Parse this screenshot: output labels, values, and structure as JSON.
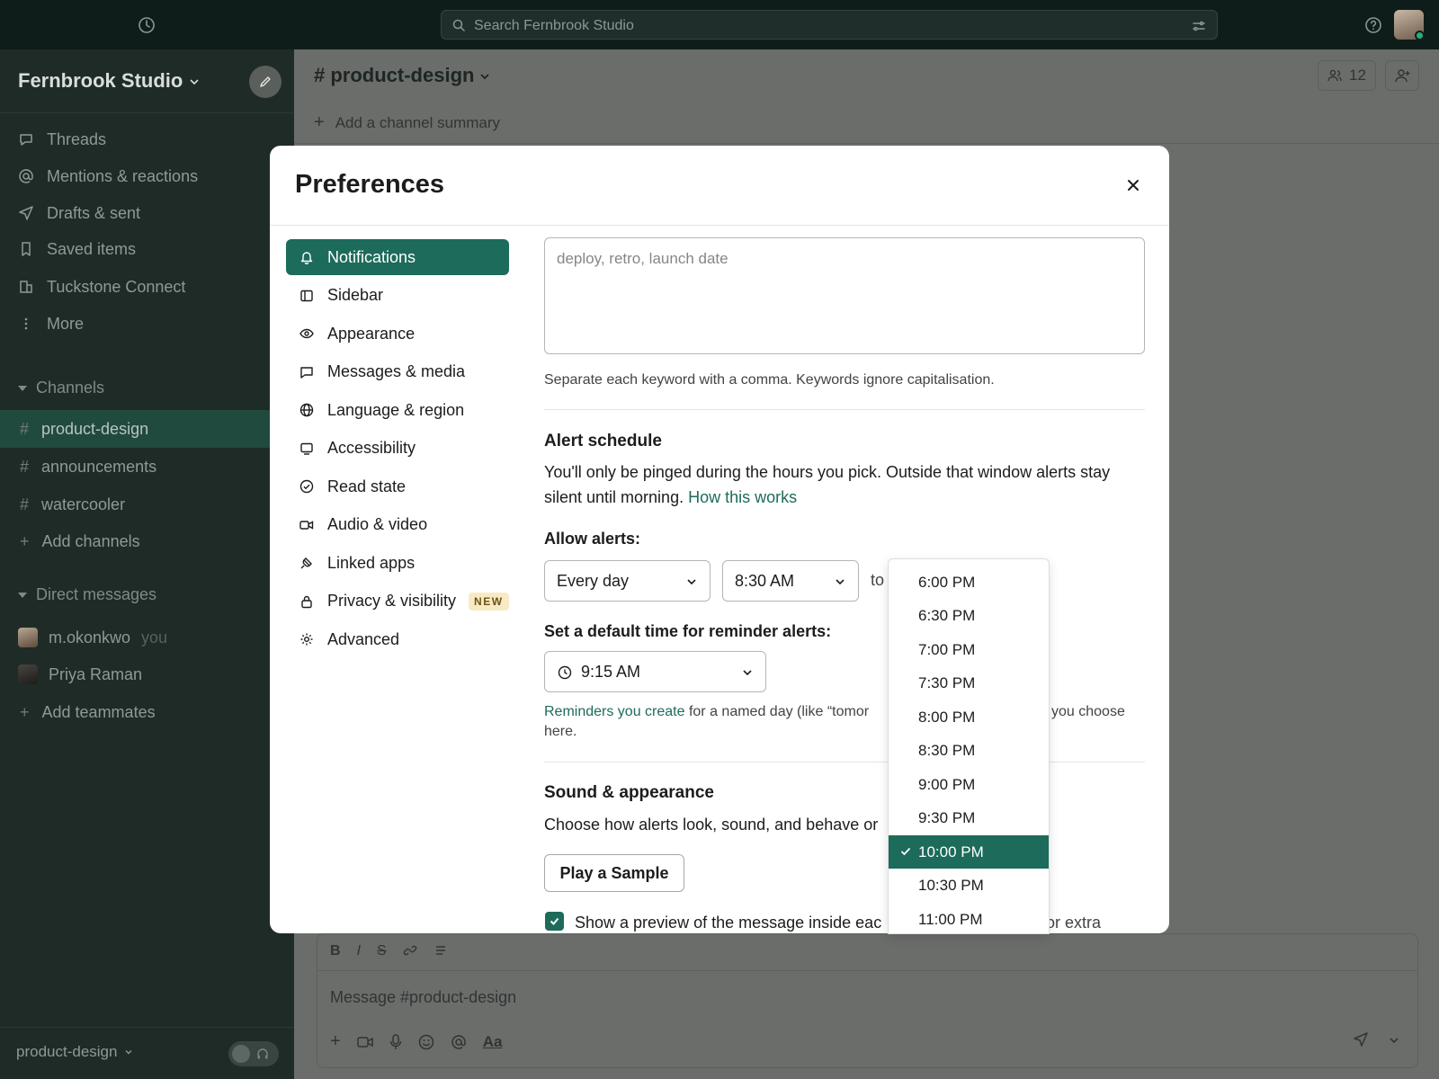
{
  "topbar": {
    "search_placeholder": "Search Fernbrook Studio"
  },
  "sidebar": {
    "workspace": "Fernbrook Studio",
    "nav": [
      {
        "label": "Threads",
        "icon": "threads-icon"
      },
      {
        "label": "Mentions & reactions",
        "icon": "at-icon"
      },
      {
        "label": "Drafts & sent",
        "icon": "send-icon"
      },
      {
        "label": "Saved items",
        "icon": "bookmark-icon"
      },
      {
        "label": "Tuckstone Connect",
        "icon": "connect-icon"
      },
      {
        "label": "More",
        "icon": "more-icon"
      }
    ],
    "channels_heading": "Channels",
    "channels": [
      "product-design",
      "announcements",
      "watercooler"
    ],
    "add_channels": "Add channels",
    "dm_heading": "Direct messages",
    "dms": [
      {
        "name": "m.okonkwo",
        "suffix": "you"
      },
      {
        "name": "Priya Raman",
        "suffix": ""
      }
    ],
    "add_teammates": "Add teammates",
    "footer_channel": "product-design"
  },
  "channel": {
    "title": "# product-design",
    "members_count": "12",
    "summary": "Add a channel summary",
    "composer_placeholder": "Message #product-design",
    "format_buttons": [
      "B",
      "I",
      "S"
    ],
    "aa_label": "Aa"
  },
  "modal": {
    "title": "Preferences",
    "menu": [
      {
        "label": "Notifications",
        "icon": "bell-icon",
        "active": true
      },
      {
        "label": "Sidebar",
        "icon": "sidebar-icon"
      },
      {
        "label": "Appearance",
        "icon": "eye-icon"
      },
      {
        "label": "Messages & media",
        "icon": "message-icon"
      },
      {
        "label": "Language & region",
        "icon": "globe-icon"
      },
      {
        "label": "Accessibility",
        "icon": "monitor-icon"
      },
      {
        "label": "Read state",
        "icon": "check-circle-icon"
      },
      {
        "label": "Audio & video",
        "icon": "video-icon"
      },
      {
        "label": "Linked apps",
        "icon": "plug-icon"
      },
      {
        "label": "Privacy & visibility",
        "icon": "lock-icon",
        "badge": "NEW"
      },
      {
        "label": "Advanced",
        "icon": "gear-icon"
      }
    ],
    "keywords_placeholder": "deploy, retro, launch date",
    "keywords_hint": "Separate each keyword with a comma. Keywords ignore capitalisation.",
    "alert_schedule_title": "Alert schedule",
    "alert_schedule_text": "You'll only be pinged during the hours you pick. Outside that window alerts stay silent until morning.",
    "alert_schedule_link": "How this works",
    "allow_alerts_label": "Allow alerts:",
    "days_value": "Every day",
    "from_value": "8:30 AM",
    "to_label": "to",
    "reminder_label": "Set a default time for reminder alerts:",
    "reminder_value": "9:15 AM",
    "reminder_note_link": "Reminders you create",
    "reminder_note_text_a": " for a named day (like “tomor",
    "reminder_note_text_b": "you choose",
    "reminder_note_text_c": "here.",
    "sound_title": "Sound & appearance",
    "sound_text": "Choose how alerts look, sound, and behave or",
    "play_sample": "Play a Sample",
    "preview_label": "Show a preview of the message inside eac",
    "preview_label_tail": "or extra"
  },
  "dropdown": {
    "options": [
      "6:00 PM",
      "6:30 PM",
      "7:00 PM",
      "7:30 PM",
      "8:00 PM",
      "8:30 PM",
      "9:00 PM",
      "9:30 PM",
      "10:00 PM",
      "10:30 PM",
      "11:00 PM"
    ],
    "selected": "10:00 PM"
  },
  "colors": {
    "accent": "#1d6b5a",
    "sidebar_bg": "#1f2b27",
    "topbar_bg": "#0f1d1a",
    "new_badge_bg": "#f8eac4"
  }
}
